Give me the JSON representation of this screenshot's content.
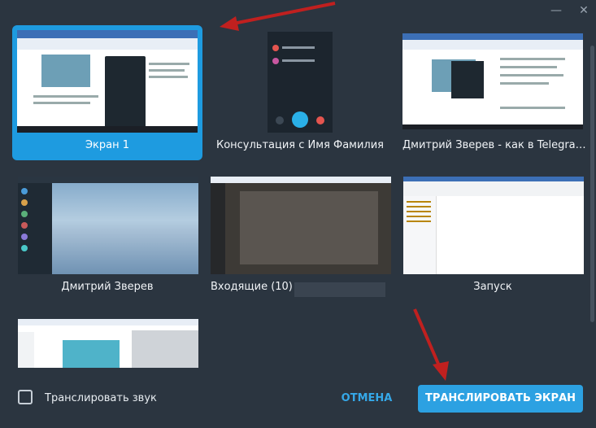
{
  "window": {
    "minimize_icon": "minimize-icon",
    "close_icon": "close-icon"
  },
  "sources": [
    {
      "label": "Экран 1",
      "selected": true
    },
    {
      "label": "Консультация с Имя Фамилия",
      "selected": false
    },
    {
      "label": "Дмитрий Зверев - как в Telegra…",
      "selected": false
    },
    {
      "label": "Дмитрий Зверев",
      "selected": false
    },
    {
      "label": "Входящие (10) - ",
      "selected": false
    },
    {
      "label": "Запуск",
      "selected": false
    },
    {
      "label": "",
      "selected": false
    }
  ],
  "footer": {
    "sound_label": "Транслировать звук",
    "sound_checked": false,
    "cancel_label": "ОТМЕНА",
    "share_label": "ТРАНСЛИРОВАТЬ ЭКРАН"
  },
  "colors": {
    "accent": "#2ca1e2",
    "background": "#2b3540",
    "arrow": "#c0201f"
  }
}
